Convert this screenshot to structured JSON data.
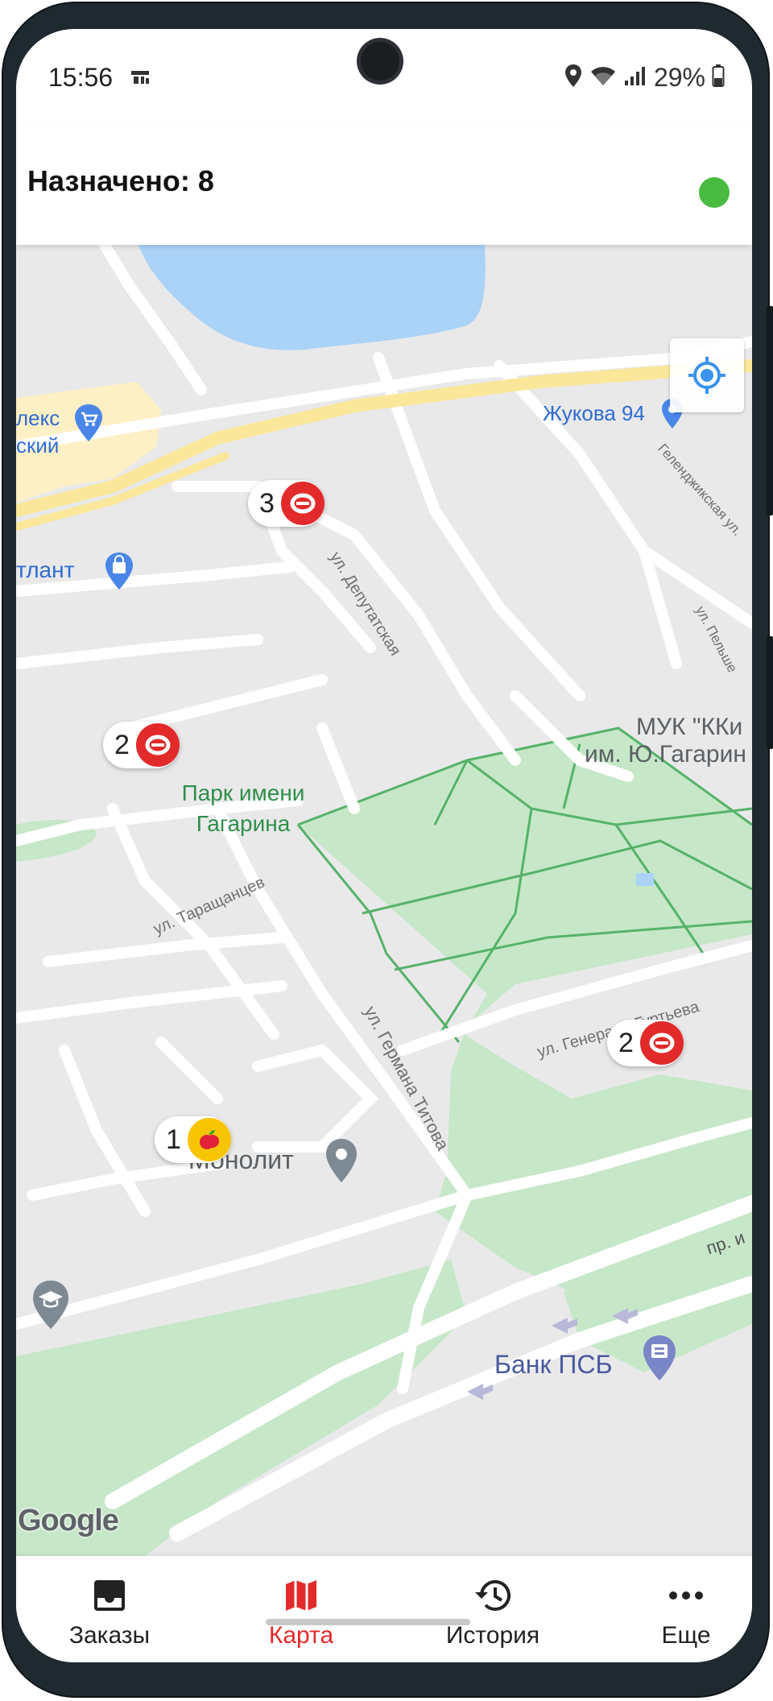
{
  "status_bar": {
    "time": "15:56",
    "battery": "29%"
  },
  "header": {
    "title": "Назначено: 8",
    "status_color": "#48bb40"
  },
  "map": {
    "streets": {
      "deputatskaya": "ул. Депутатская",
      "taraschantsev": "ул. Таращанцев",
      "titova": "ул. Германа Титова",
      "gurtyeva": "ул. Генерала Гуртьева",
      "gelendzhikskaya": "Геленджикская ул.",
      "pelshe": "ул. Пельше",
      "avenue": "пр. и"
    },
    "labels": {
      "park": "Парк имени\nГагарина",
      "muk_line1": "МУК \"ККи",
      "muk_line2": "им. Ю.Гагарин",
      "zhukova": "Жукова 94",
      "lex_line1": "лекс",
      "lex_line2": "ский",
      "atlant": "тлант",
      "monolit": "Монолит",
      "bank": "Банк ПСБ",
      "google": "Google"
    },
    "markers": [
      {
        "count": "3",
        "brand": "red-circle"
      },
      {
        "count": "2",
        "brand": "red-circle"
      },
      {
        "count": "2",
        "brand": "red-circle"
      },
      {
        "count": "1",
        "brand": "apple-yellow"
      }
    ],
    "colors": {
      "water": "#aad3f7",
      "park": "#c6e7c8",
      "road": "#ffffff",
      "highway": "#fbe79a",
      "brand_red": "#e22a2a",
      "brand_yellow": "#f7c500"
    }
  },
  "nav": {
    "items": [
      {
        "label": "Заказы",
        "icon": "inbox-icon"
      },
      {
        "label": "Карта",
        "icon": "map-icon",
        "active": true
      },
      {
        "label": "История",
        "icon": "history-icon"
      },
      {
        "label": "Еще",
        "icon": "more-icon"
      }
    ],
    "active_color": "#e22a2a"
  }
}
